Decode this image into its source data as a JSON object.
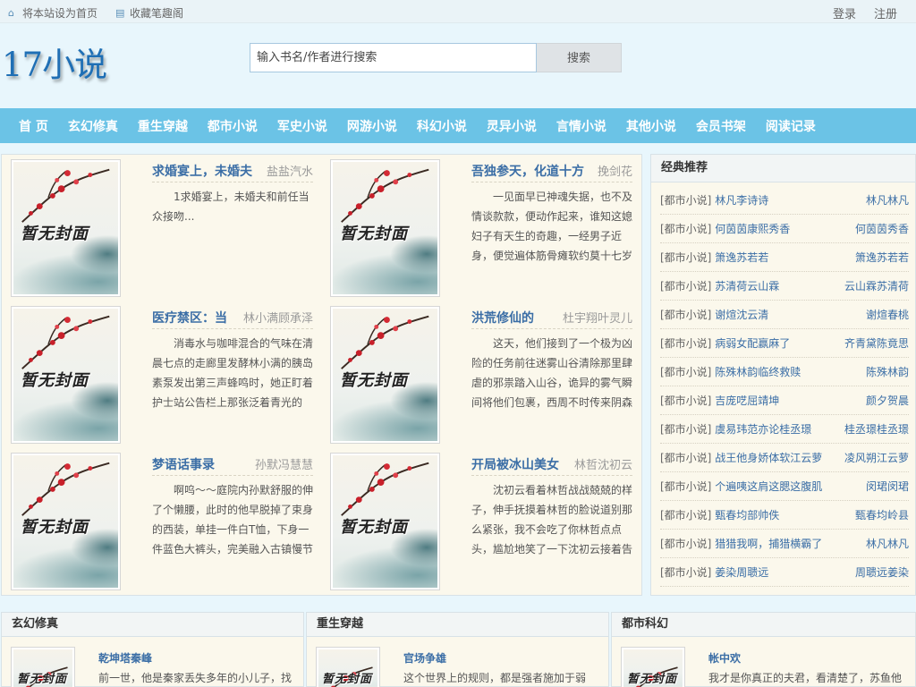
{
  "topbar": {
    "set_home": "将本站设为首页",
    "bookmark": "收藏笔趣阁",
    "login": "登录",
    "register": "注册"
  },
  "header": {
    "logo": "17小说",
    "search_placeholder": "输入书名/作者进行搜索",
    "search_button": "搜索"
  },
  "nav": [
    "首 页",
    "玄幻修真",
    "重生穿越",
    "都市小说",
    "军史小说",
    "网游小说",
    "科幻小说",
    "灵异小说",
    "言情小说",
    "其他小说",
    "会员书架",
    "阅读记录"
  ],
  "cover_text": "暂无封面",
  "books": [
    {
      "title": "求婚宴上，未婚夫",
      "author": "盐盐汽水",
      "desc": "1求婚宴上，未婚夫和前任当众接吻..."
    },
    {
      "title": "吾独参天，化道十方",
      "author": "挽剑花",
      "desc": "一见面早已神魂失据，也不及情谈款款，便动作起来，谁知这媳妇子有天生的奇趣，一经男子近身，便觉遍体筋骨瘫软约莫十七岁"
    },
    {
      "title": "医疗禁区：当",
      "author": "林小满顾承泽",
      "desc": "消毒水与咖啡混合的气味在清晨七点的走廊里发酵林小满的胰岛素泵发出第三声蜂鸣时，她正盯着护士站公告栏上那张泛着青光的"
    },
    {
      "title": "洪荒修仙的",
      "author": "杜宇翔叶灵儿",
      "desc": "这天，他们接到了一个极为凶险的任务前往迷雾山谷清除那里肆虐的邪祟踏入山谷，诡异的雾气瞬间将他们包裹，西周不时传来阴森"
    },
    {
      "title": "梦语话事录",
      "author": "孙默冯慧慧",
      "desc": "啊呜～～庭院内孙默舒服的伸了个懒腰，此时的他早脱掉了束身的西装，单挂一件白T恤，下身一件蓝色大裤头，完美融入古镇慢节"
    },
    {
      "title": "开局被冰山美女",
      "author": "林哲沈初云",
      "desc": "沈初云看着林哲战战兢兢的样子，伸手抚摸着林哲的脸说道别那么紧张，我不会吃了你林哲点点头，尴尬地笑了一下沈初云接着告"
    }
  ],
  "sidebar": {
    "title": "经典推荐",
    "items": [
      {
        "cat": "[都市小说]",
        "title": "林凡李诗诗",
        "author": "林凡林凡"
      },
      {
        "cat": "[都市小说]",
        "title": "何茵茵康熙秀香",
        "author": "何茵茵秀香"
      },
      {
        "cat": "[都市小说]",
        "title": "箫逸苏若若",
        "author": "箫逸苏若若"
      },
      {
        "cat": "[都市小说]",
        "title": "苏清荷云山霖",
        "author": "云山霖苏清荷"
      },
      {
        "cat": "[都市小说]",
        "title": "谢煊沈云清",
        "author": "谢煊春桃"
      },
      {
        "cat": "[都市小说]",
        "title": "病弱女配赢麻了",
        "author": "齐青黛陈竟思"
      },
      {
        "cat": "[都市小说]",
        "title": "陈殊林韵临终救赎",
        "author": "陈殊林韵"
      },
      {
        "cat": "[都市小说]",
        "title": "吉庞呓屈靖坤",
        "author": "颜夕贺晨"
      },
      {
        "cat": "[都市小说]",
        "title": "虞易玮范亦论桂丞璟",
        "author": "桂丞璟桂丞璟"
      },
      {
        "cat": "[都市小说]",
        "title": "战王他身娇体软江云萝",
        "author": "凌风朔江云萝"
      },
      {
        "cat": "[都市小说]",
        "title": "个遍咦这肩这腮这腹肌",
        "author": "闵珺闵珺"
      },
      {
        "cat": "[都市小说]",
        "title": "甄春均部帅佚",
        "author": "甄春均岭县"
      },
      {
        "cat": "[都市小说]",
        "title": "猎猎我啊，捕猎横霸了",
        "author": "林凡林凡"
      },
      {
        "cat": "[都市小说]",
        "title": "姜染周聩远",
        "author": "周聩远姜染"
      }
    ]
  },
  "bottom": [
    {
      "head": "玄幻修真",
      "title": "乾坤塔秦峰",
      "desc": "前一世，他是秦家丢失多年的小儿子，找"
    },
    {
      "head": "重生穿越",
      "title": "官场争雄",
      "desc": "这个世界上的规则，都是强者施加于弱"
    },
    {
      "head": "都市科幻",
      "title": "帐中欢",
      "desc": "我才是你真正的夫君，看清楚了，苏鱼他"
    }
  ]
}
